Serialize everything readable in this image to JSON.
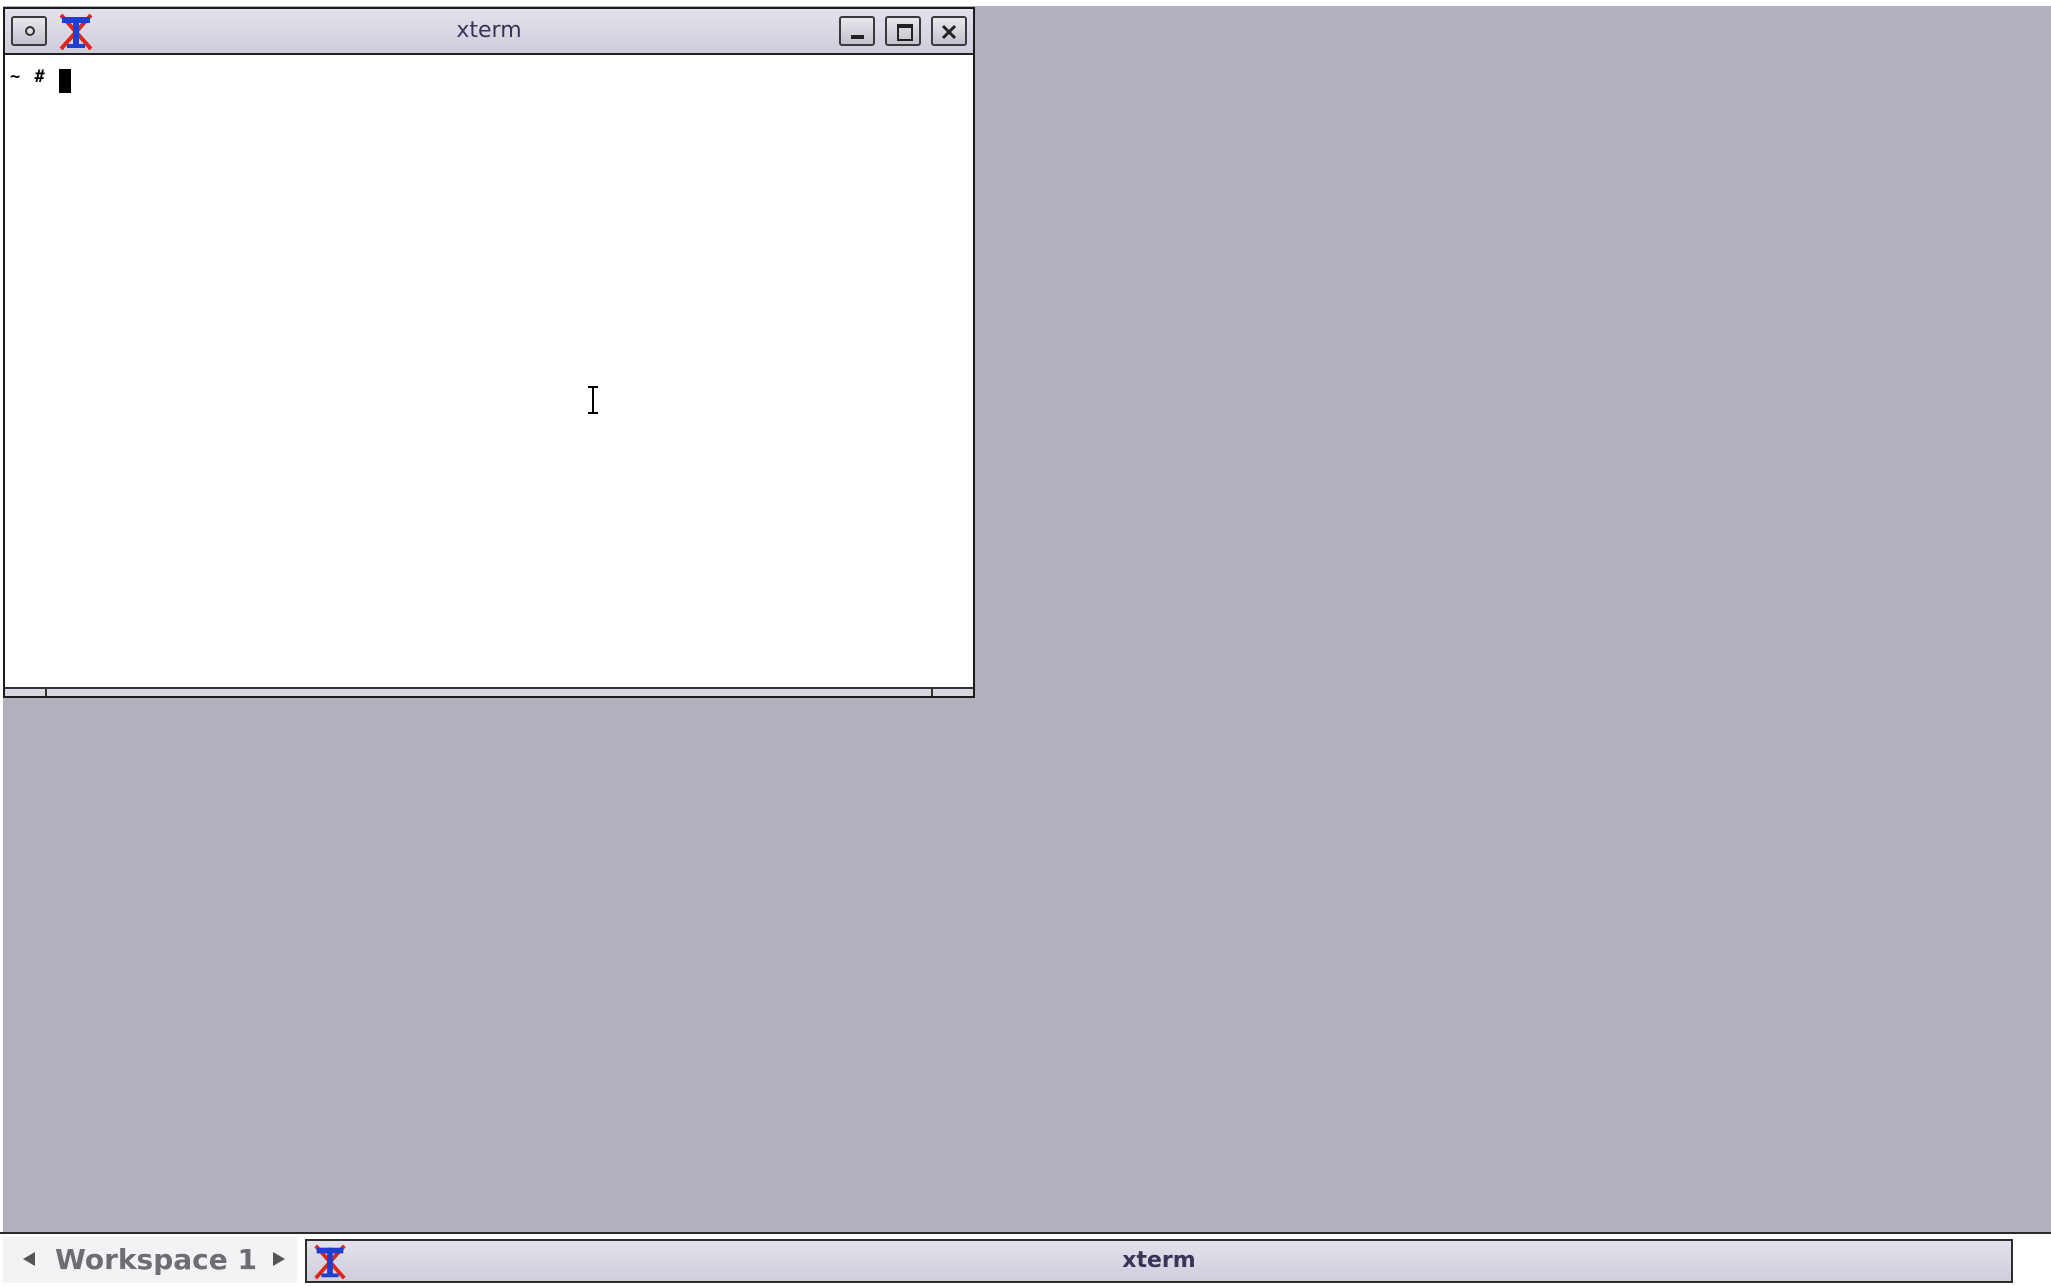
{
  "window": {
    "title": "xterm",
    "icon": "xterm-logo-icon",
    "buttons": {
      "menu": "window-menu-icon",
      "minimize": "minimize-icon",
      "maximize": "maximize-icon",
      "close": "close-icon"
    }
  },
  "terminal": {
    "prompt": "~ #",
    "background": "#ffffff",
    "foreground": "#000000"
  },
  "taskbar": {
    "workspace_label": "Workspace 1",
    "prev_icon": "triangle-left-icon",
    "next_icon": "triangle-right-icon",
    "tasks": [
      {
        "label": "xterm",
        "icon": "xterm-logo-icon"
      }
    ]
  },
  "colors": {
    "desktop": "#b1b0bc",
    "titlebar": "#d8d7e2",
    "title_text": "#3b3459",
    "workspace_text": "#6e6e72"
  }
}
